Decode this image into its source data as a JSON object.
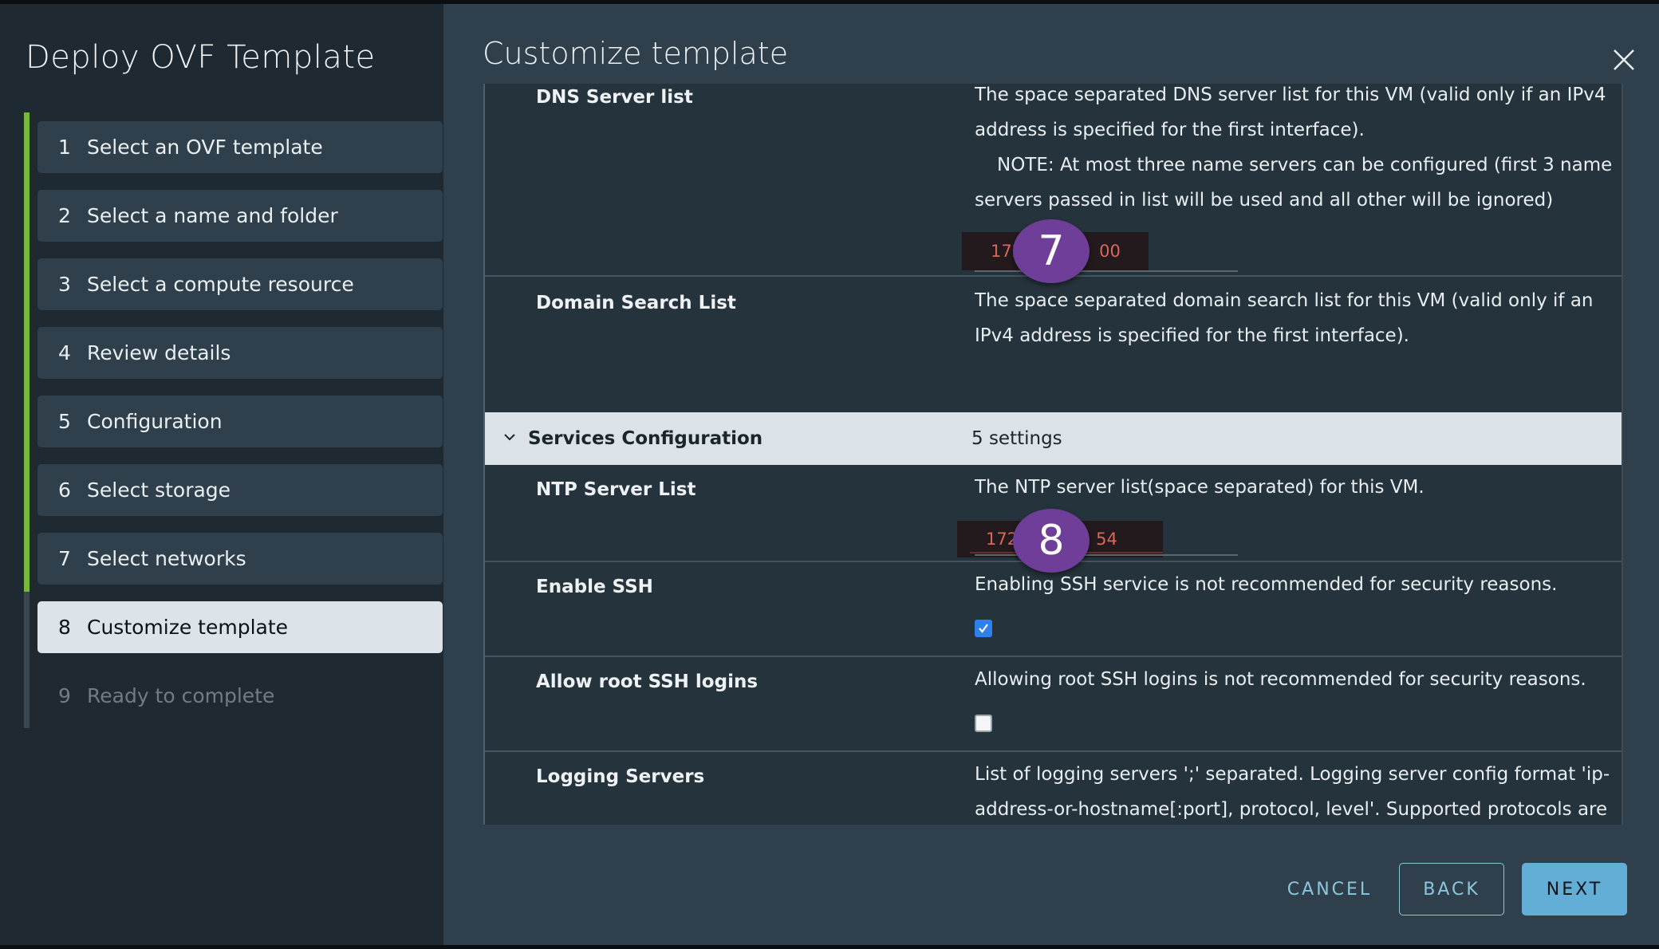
{
  "wizard": {
    "title": "Deploy OVF Template",
    "progress_completed_steps": 7,
    "progress_total_steps": 9,
    "steps": [
      {
        "num": "1",
        "label": "Select an OVF template",
        "state": "completed"
      },
      {
        "num": "2",
        "label": "Select a name and folder",
        "state": "completed"
      },
      {
        "num": "3",
        "label": "Select a compute resource",
        "state": "completed"
      },
      {
        "num": "4",
        "label": "Review details",
        "state": "completed"
      },
      {
        "num": "5",
        "label": "Configuration",
        "state": "completed"
      },
      {
        "num": "6",
        "label": "Select storage",
        "state": "completed"
      },
      {
        "num": "7",
        "label": "Select networks",
        "state": "completed"
      },
      {
        "num": "8",
        "label": "Customize template",
        "state": "active"
      },
      {
        "num": "9",
        "label": "Ready to complete",
        "state": "disabled"
      }
    ]
  },
  "main": {
    "title": "Customize template",
    "close_icon": "close-icon",
    "rows": {
      "dns": {
        "label": "DNS Server list",
        "description_line1": "The space separated DNS server list for this VM (valid only if an IPv4",
        "description_line2": "address is specified for the first interface).",
        "description_line3": "NOTE: At most three name servers can be configured (first 3 name",
        "description_line4": "servers passed in list will be used and all other will be ignored)",
        "value_prefix": "172",
        "value_suffix": "00",
        "annotation": "7"
      },
      "domain_search": {
        "label": "Domain Search List",
        "description_line1": "The space separated domain search list for this VM (valid only if an",
        "description_line2": "IPv4 address is specified for the first interface).",
        "value": ""
      },
      "services_group": {
        "label": "Services Configuration",
        "count": "5 settings",
        "expanded": true
      },
      "ntp": {
        "label": "NTP Server List",
        "description": "The NTP server list(space separated) for this VM.",
        "value_prefix": "172",
        "value_suffix": "54",
        "annotation": "8"
      },
      "enable_ssh": {
        "label": "Enable SSH",
        "description": "Enabling SSH service is not recommended for security reasons.",
        "checked": true
      },
      "root_ssh": {
        "label": "Allow root SSH logins",
        "description": "Allowing root SSH logins is not recommended for security reasons.",
        "checked": false
      },
      "logging": {
        "label": "Logging Servers",
        "description_line1": "List of logging servers ';' separated. Logging server config format 'ip-",
        "description_line2": "address-or-hostname[:port], protocol, level'. Supported protocols are"
      }
    }
  },
  "footer": {
    "cancel_label": "CANCEL",
    "back_label": "BACK",
    "next_label": "NEXT"
  },
  "colors": {
    "progress_green": "#77b83c",
    "primary_button": "#62aed6",
    "link_blue": "#8cc7dd",
    "annotation_purple": "#6e3e98",
    "error_red": "#d9675c",
    "checkbox_blue": "#2f80ed"
  }
}
